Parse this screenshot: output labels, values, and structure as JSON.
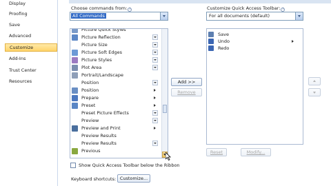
{
  "sidebar": {
    "items": [
      {
        "label": "Display"
      },
      {
        "label": "Proofing"
      },
      {
        "label": "Save"
      },
      {
        "label": "Advanced"
      },
      {
        "label": "Customize"
      },
      {
        "label": "Add-Ins"
      },
      {
        "label": "Trust Center"
      },
      {
        "label": "Resources"
      }
    ]
  },
  "left_panel": {
    "choose_label": "Choose commands from:",
    "choose_value": "All Commands",
    "commands": [
      {
        "label": "Picture Quick Styles",
        "icon": "quick-styles-icon",
        "color": "#7b9bc9",
        "suffix": "none"
      },
      {
        "label": "Picture Reflection",
        "icon": "picture-icon",
        "color": "#5d88c6",
        "suffix": "dropdown"
      },
      {
        "label": "Picture Size",
        "icon": "",
        "color": "",
        "suffix": "dropdown"
      },
      {
        "label": "Picture Soft Edges",
        "icon": "soft-edges-icon",
        "color": "#6d9ad6",
        "suffix": "dropdown"
      },
      {
        "label": "Picture Styles",
        "icon": "styles-icon",
        "color": "#9c7bc2",
        "suffix": "dropdown"
      },
      {
        "label": "Plot Area",
        "icon": "plot-area-icon",
        "color": "#7c8fb0",
        "suffix": "dropdown"
      },
      {
        "label": "Portrait/Landscape",
        "icon": "orientation-icon",
        "color": "#8f9fb8",
        "suffix": "none"
      },
      {
        "label": "Position",
        "icon": "",
        "color": "",
        "suffix": "dropdown"
      },
      {
        "label": "Position",
        "icon": "position-icon",
        "color": "#6a8fc4",
        "suffix": "arrow"
      },
      {
        "label": "Prepare",
        "icon": "prepare-icon",
        "color": "#4d79c0",
        "suffix": "arrow"
      },
      {
        "label": "Preset",
        "icon": "preset-icon",
        "color": "#5a86c5",
        "suffix": "arrow"
      },
      {
        "label": "Preset Picture Effects",
        "icon": "",
        "color": "",
        "suffix": "dropdown"
      },
      {
        "label": "Preview",
        "icon": "",
        "color": "",
        "suffix": "dropdown"
      },
      {
        "label": "Preview and Print",
        "icon": "preview-print-icon",
        "color": "#4a6f9e",
        "suffix": "arrow"
      },
      {
        "label": "Preview Results",
        "icon": "",
        "color": "",
        "suffix": "none"
      },
      {
        "label": "Preview Results",
        "icon": "",
        "color": "",
        "suffix": "dropdown"
      },
      {
        "label": "Previous",
        "icon": "previous-icon",
        "color": "#8aa83f",
        "suffix": "none"
      }
    ]
  },
  "middle": {
    "add_label": "Add >>",
    "remove_label": "Remove"
  },
  "right_panel": {
    "customize_label": "Customize Quick Access Toolbar:",
    "for_value": "For all documents (default)",
    "items": [
      {
        "label": "Save",
        "icon": "save-icon",
        "color": "#5d7fb0"
      },
      {
        "label": "Undo",
        "icon": "undo-icon",
        "color": "#3b66b3"
      },
      {
        "label": "Redo",
        "icon": "redo-icon",
        "color": "#3b66b3"
      }
    ],
    "reset_label": "Reset",
    "modify_label": "Modify..."
  },
  "bottom": {
    "show_below_label": "Show Quick Access Toolbar below the Ribbon",
    "keyboard_label": "Keyboard shortcuts:",
    "customize_button": "Customize..."
  }
}
